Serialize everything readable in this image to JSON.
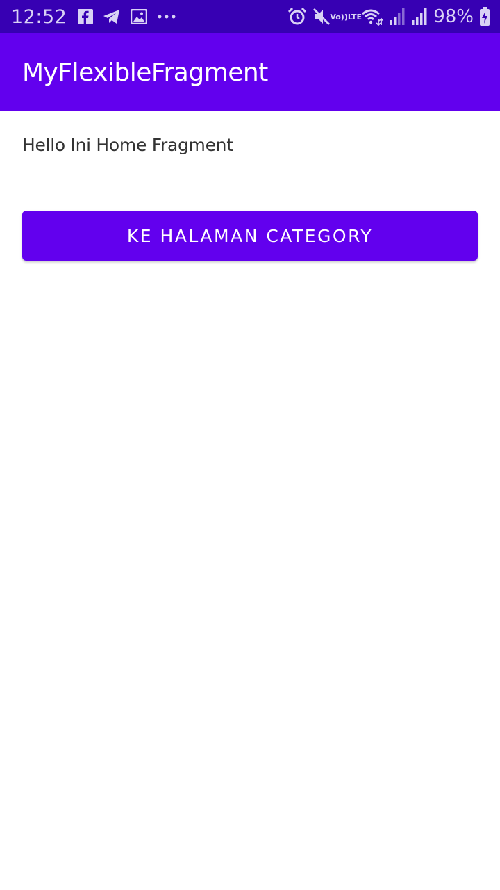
{
  "status_bar": {
    "time": "12:52",
    "left_icons": [
      "facebook-icon",
      "telegram-icon",
      "gallery-icon",
      "more-notifications-icon"
    ],
    "right_icons": [
      "alarm-icon",
      "mute-icon",
      "volte-icon",
      "wifi-icon",
      "signal-icon",
      "signal-icon",
      "battery-charging-icon"
    ],
    "volte_top": "Vo))",
    "volte_bottom": "LTE",
    "battery_percent": "98%"
  },
  "app_bar": {
    "title": "MyFlexibleFragment",
    "color": "#6200EE"
  },
  "main": {
    "hello_text": "Hello Ini Home Fragment",
    "button_label": "Ke Halaman Category",
    "button_color": "#6200EE"
  }
}
